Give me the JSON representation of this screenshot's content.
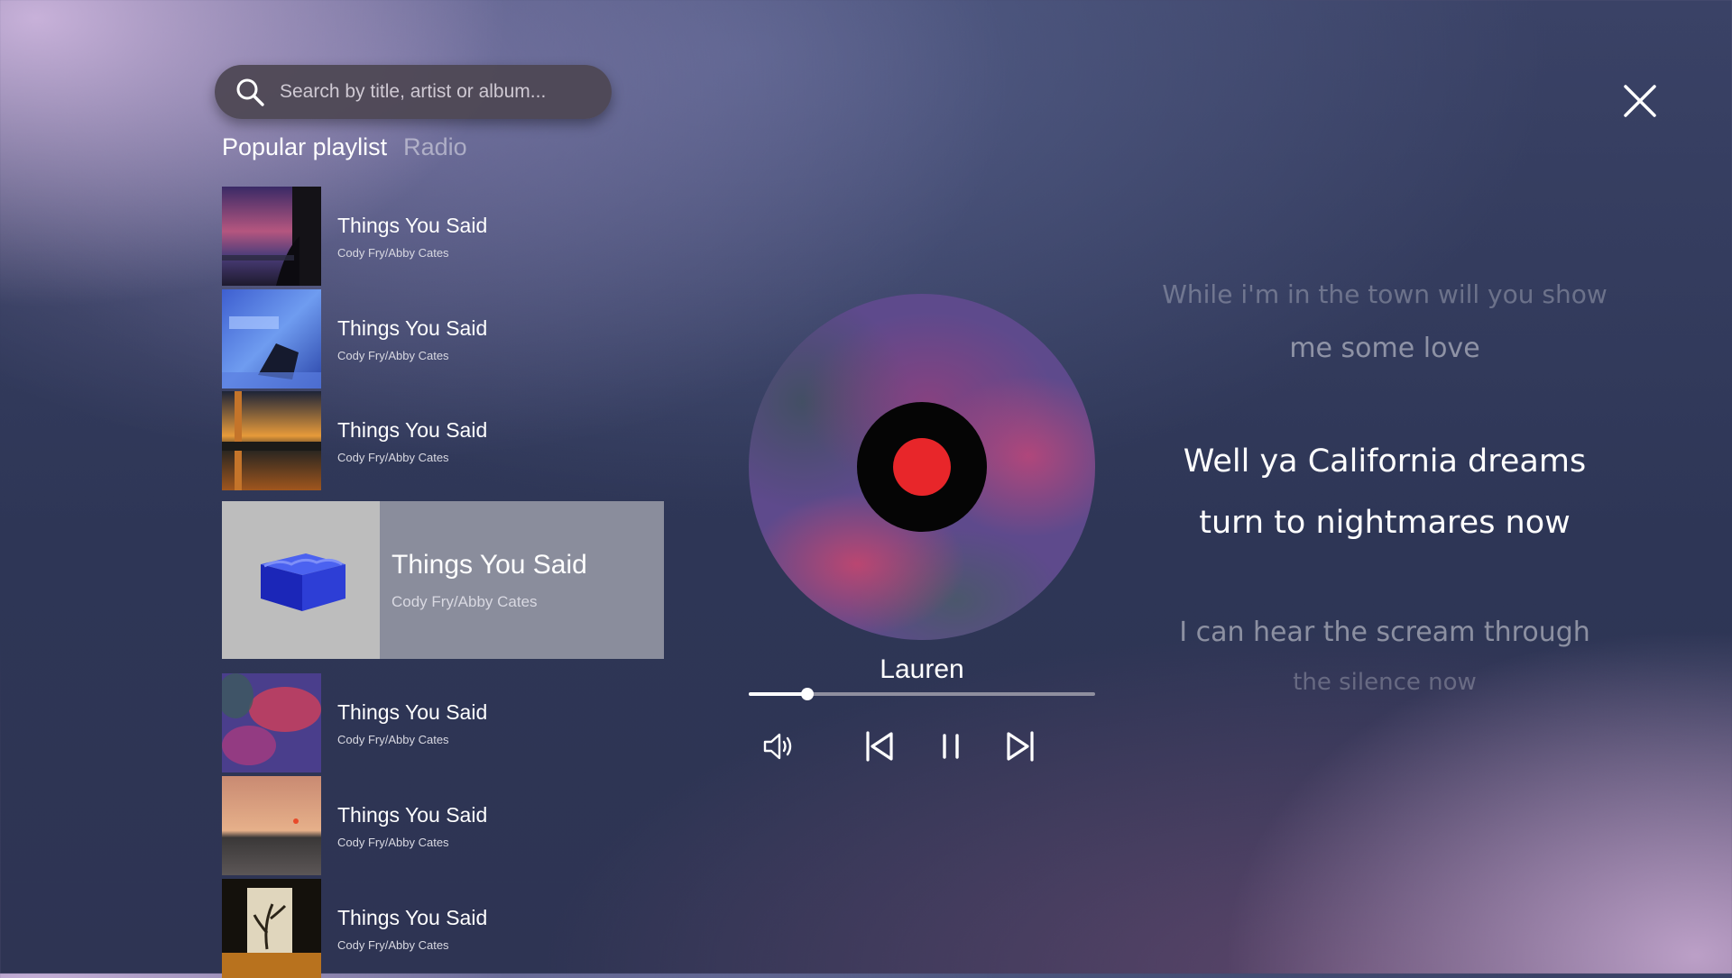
{
  "search": {
    "placeholder": "Search by title, artist or album..."
  },
  "tabs": [
    {
      "label": "Popular playlist",
      "active": true
    },
    {
      "label": "Radio",
      "active": false
    }
  ],
  "playlist": [
    {
      "title": "Things You Said",
      "artist": "Cody Fry/Abby Cates",
      "thumb": "sunset-window"
    },
    {
      "title": "Things You Said",
      "artist": "Cody Fry/Abby Cates",
      "thumb": "blue-room-chair"
    },
    {
      "title": "Things You Said",
      "artist": "Cody Fry/Abby Cates",
      "thumb": "city-dusk"
    },
    {
      "title": "Things You Said",
      "artist": "Cody Fry/Abby Cates",
      "thumb": "blue-cube",
      "selected": true
    },
    {
      "title": "Things You Said",
      "artist": "Cody Fry/Abby Cates",
      "thumb": "pink-blur"
    },
    {
      "title": "Things You Said",
      "artist": "Cody Fry/Abby Cates",
      "thumb": "sea-sunset"
    },
    {
      "title": "Things You Said",
      "artist": "Cody Fry/Abby Cates",
      "thumb": "flower-vase"
    }
  ],
  "player": {
    "song_title": "Lauren",
    "progress": 0.17,
    "controls": [
      "volume-icon",
      "previous-icon",
      "pause-icon",
      "next-icon"
    ],
    "accent": "#e8262a"
  },
  "lyrics": {
    "previous": [
      "While i'm in the town will you show",
      "me some love"
    ],
    "current": [
      "Well ya California dreams",
      "turn to nightmares now"
    ],
    "next": [
      "I can hear the scream through",
      "the silence now"
    ]
  }
}
